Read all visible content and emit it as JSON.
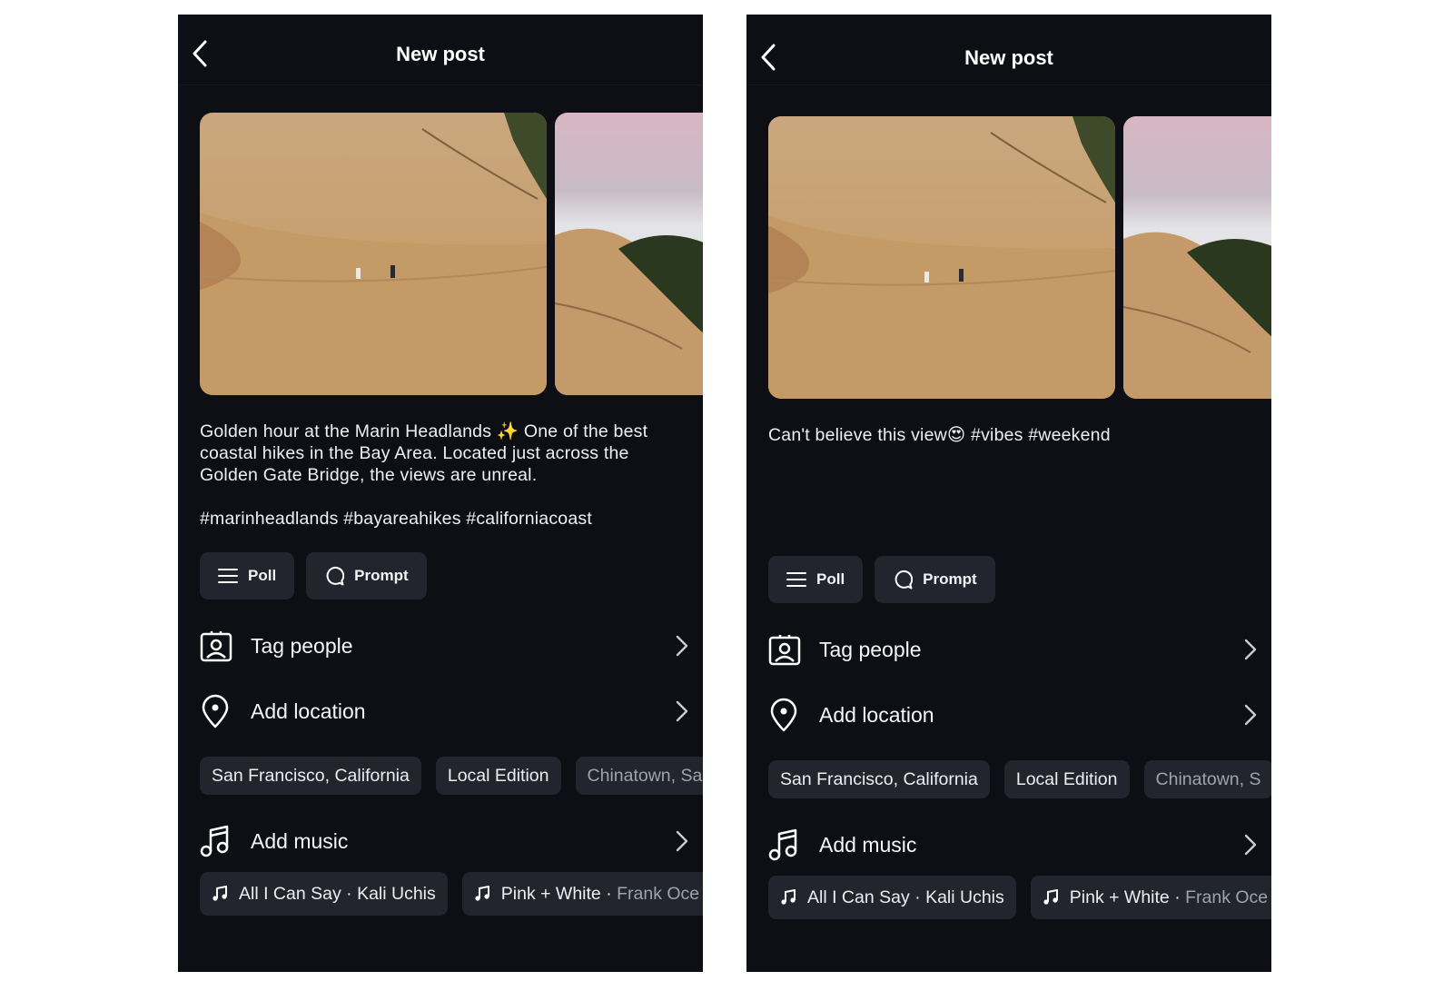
{
  "screens": [
    {
      "header": {
        "title": "New post"
      },
      "caption": {
        "text": "Golden hour at the Marin Headlands ✨ One of the best coastal hikes in the Bay Area. Located just across the Golden Gate Bridge, the views are unreal.",
        "hashtags": "#marinheadlands #bayareahikes #californiacoast"
      },
      "actions": {
        "poll": "Poll",
        "prompt": "Prompt"
      },
      "rows": {
        "tag_people": "Tag people",
        "add_location": "Add location",
        "add_music": "Add music"
      },
      "locations": [
        "San Francisco, California",
        "Local Edition",
        "Chinatown, Sa"
      ],
      "music": [
        {
          "title": "All I Can Say",
          "artist": "Kali Uchis"
        },
        {
          "title": "Pink + White",
          "artist": "Frank Oce"
        }
      ]
    },
    {
      "header": {
        "title": "New post"
      },
      "caption": {
        "text": "Can't believe this view😍 #vibes #weekend",
        "hashtags": ""
      },
      "actions": {
        "poll": "Poll",
        "prompt": "Prompt"
      },
      "rows": {
        "tag_people": "Tag people",
        "add_location": "Add location",
        "add_music": "Add music"
      },
      "locations": [
        "San Francisco, California",
        "Local Edition",
        "Chinatown, S"
      ],
      "music": [
        {
          "title": "All I Can Say",
          "artist": "Kali Uchis"
        },
        {
          "title": "Pink + White",
          "artist": "Frank Oce"
        }
      ]
    }
  ],
  "icons": {
    "back": "chevron-left-icon",
    "poll": "list-lines-icon",
    "prompt": "speech-bubble-icon",
    "tag_people": "person-portrait-icon",
    "location": "map-pin-icon",
    "music": "music-note-icon",
    "chevron": "chevron-right-icon"
  },
  "colors": {
    "background": "#0d0f14",
    "chip": "#22252d",
    "text": "#f2f3f5",
    "muted": "#9fa3ab"
  }
}
